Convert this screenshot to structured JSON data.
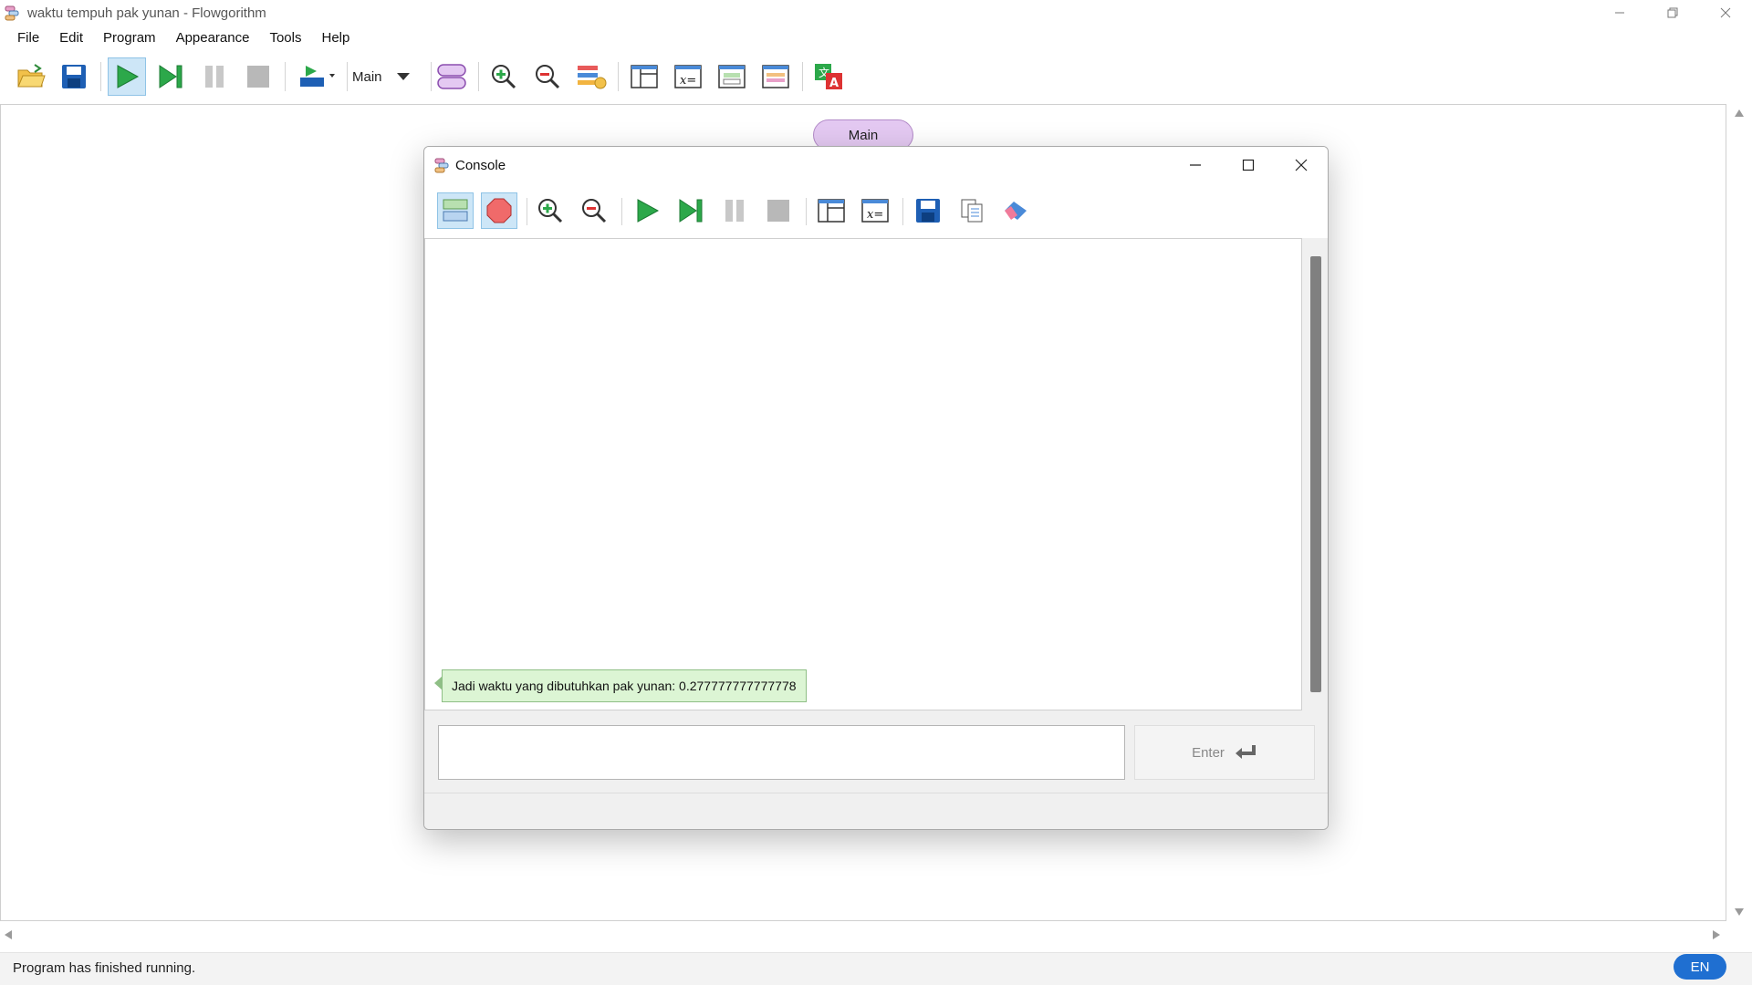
{
  "window": {
    "title": "waktu tempuh pak yunan - Flowgorithm"
  },
  "menu": [
    "File",
    "Edit",
    "Program",
    "Appearance",
    "Tools",
    "Help"
  ],
  "toolbar": {
    "function_select": "Main"
  },
  "canvas": {
    "main_terminal": "Main"
  },
  "console": {
    "title": "Console",
    "output_message": "Jadi waktu yang dibutuhkan pak yunan: 0.277777777777778",
    "input_value": "",
    "enter_label": "Enter"
  },
  "status": {
    "text": "Program has finished running.",
    "language": "EN"
  },
  "colors": {
    "terminal_fill": "#e4c9f2",
    "output_bubble": "#dcf5d4",
    "active_button": "#cde6f7",
    "language_badge": "#1f6fd1"
  }
}
